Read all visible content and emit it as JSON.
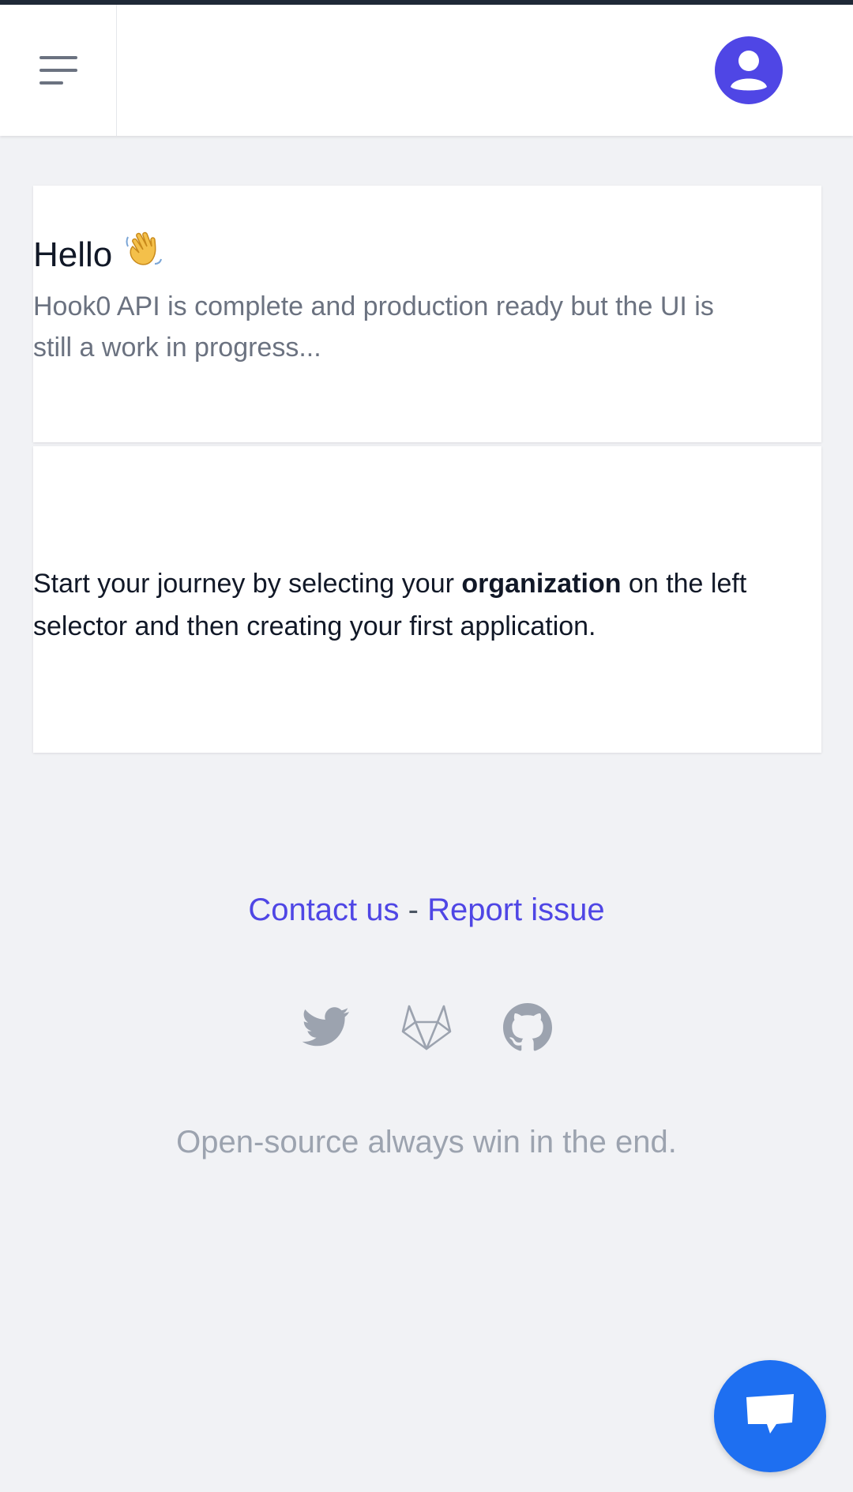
{
  "header": {
    "menu_icon": "menu-icon",
    "avatar_icon": "user-avatar-icon",
    "avatar_color": "#4f46e5"
  },
  "welcome_card": {
    "title": "Hello",
    "wave_icon": "waving-hand-icon",
    "subtitle": "Hook0 API is complete and production ready but the UI is still a work in progress..."
  },
  "journey_card": {
    "text_before": "Start your journey by selecting your ",
    "text_bold": "organization",
    "text_after": " on the left selector and then creating your first application."
  },
  "footer": {
    "contact_label": "Contact us",
    "separator": "-",
    "report_label": "Report issue",
    "link_color": "#4f46e5",
    "social_icons": [
      "twitter-icon",
      "gitlab-icon",
      "github-icon"
    ],
    "tagline": "Open-source always win in the end."
  },
  "chat": {
    "icon": "chat-icon",
    "color": "#1e6ff1"
  }
}
